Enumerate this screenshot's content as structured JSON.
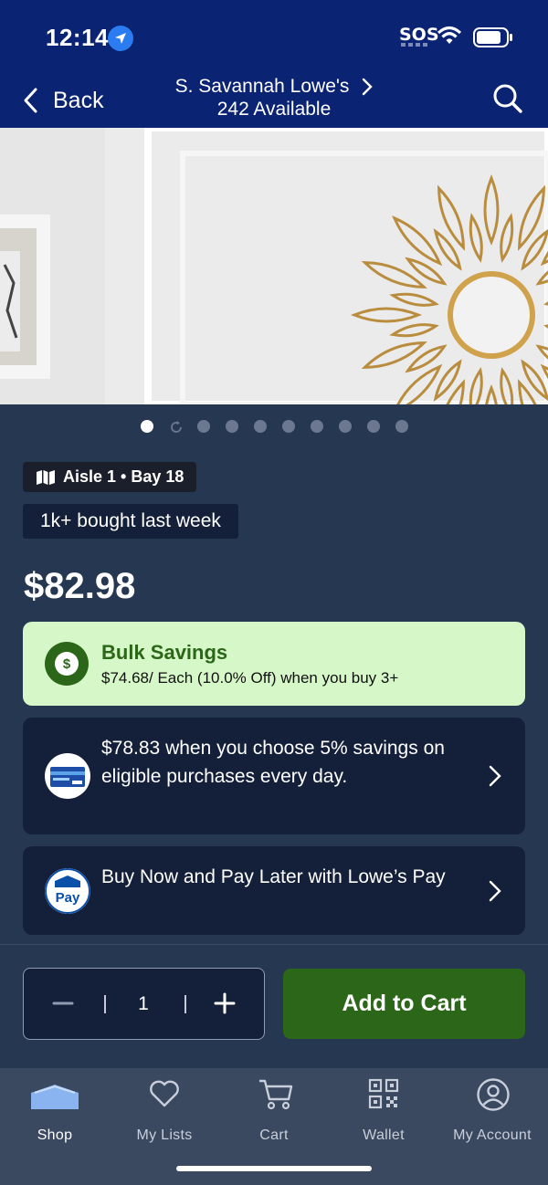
{
  "status_bar": {
    "time": "12:14",
    "sos": "SOS"
  },
  "nav": {
    "back_label": "Back",
    "store_name": "S. Savannah Lowe's",
    "availability": "242 Available"
  },
  "gallery": {
    "total_images": 10,
    "active_index": 0
  },
  "product": {
    "location": "Aisle 1 • Bay 18",
    "popularity": "1k+ bought last week",
    "price": "$82.98"
  },
  "bulk_savings": {
    "title": "Bulk Savings",
    "description": "$74.68/ Each (10.0% Off) when you buy 3+",
    "icon_symbol": "$"
  },
  "offers": [
    {
      "text": "$78.83 when you choose 5% savings on eligible purchases every day.",
      "icon": "credit-card-icon"
    },
    {
      "text": "Buy Now and Pay Later with Lowe’s Pay",
      "icon": "lowes-pay-icon"
    }
  ],
  "quantity": {
    "value": "1"
  },
  "actions": {
    "add_to_cart": "Add to Cart"
  },
  "tabs": [
    {
      "label": "Shop",
      "icon": "shop-icon",
      "active": true
    },
    {
      "label": "My Lists",
      "icon": "heart-icon",
      "active": false
    },
    {
      "label": "Cart",
      "icon": "cart-icon",
      "active": false
    },
    {
      "label": "Wallet",
      "icon": "qr-code-icon",
      "active": false
    },
    {
      "label": "My Account",
      "icon": "account-icon",
      "active": false
    }
  ],
  "colors": {
    "header_bg": "#0a2373",
    "page_bg": "#263752",
    "card_bg": "#14203a",
    "bulk_bg": "#d6f7c7",
    "brand_green": "#2c6618",
    "tab_bar_bg": "#3a4860"
  }
}
